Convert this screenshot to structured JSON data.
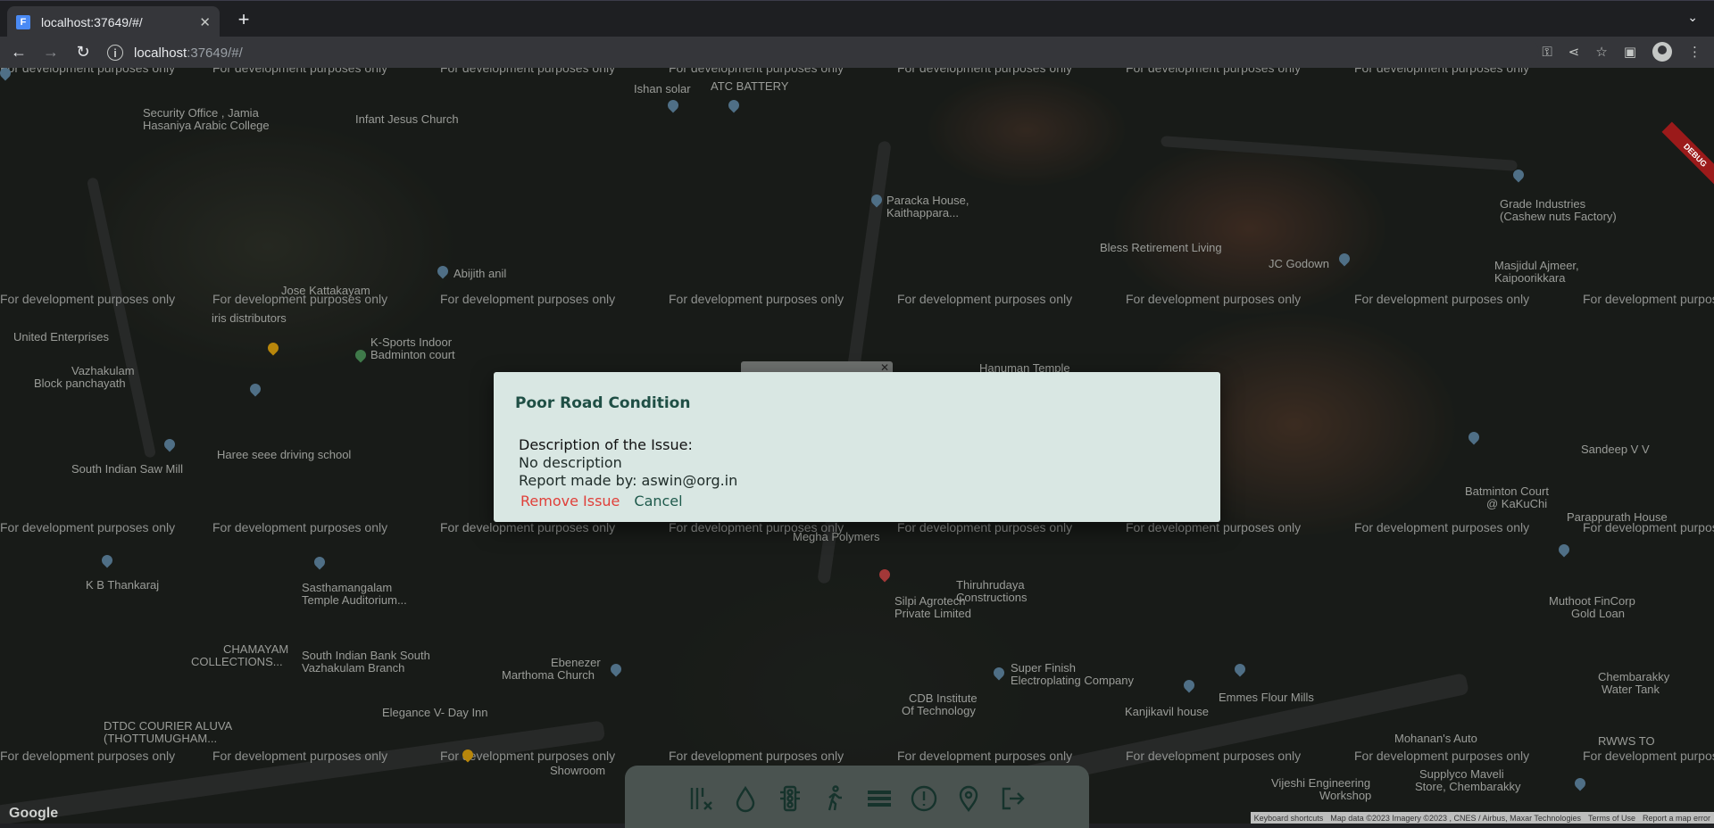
{
  "browser": {
    "tab_title": "localhost:37649/#/",
    "tab_close": "✕",
    "new_tab": "+",
    "url_host": "localhost",
    "url_path": ":37649/#/"
  },
  "map": {
    "watermark": "For development purposes only",
    "debug_label": "DEBUG",
    "google_logo": "Google",
    "attribution": [
      "Keyboard shortcuts",
      "Map data ©2023 Imagery ©2023 , CNES / Airbus, Maxar Technologies",
      "Terms of Use",
      "Report a map error"
    ],
    "places": [
      "Ishan solar",
      "ATC BATTERY",
      "Security Office , Jamia",
      "Hasaniya Arabic College",
      "Infant Jesus Church",
      "Paracka House,",
      "Kaithappara...",
      "Grade Industries",
      "(Cashew nuts Factory)",
      "Bless Retirement Living",
      "JC Godown",
      "Masjidul Ajmeer,",
      "Kaipoorikkara",
      "Abijith anil",
      "Jose Kattakayam",
      "iris distributors",
      "K-Sports Indoor",
      "Badminton court",
      "United Enterprises",
      "Vazhakulam",
      "Block panchayath",
      "Haree seee driving school",
      "South Indian Saw Mill",
      "Sandeep V V",
      "Batminton Court",
      "@ KaKuChi",
      "Parappurath House",
      "K B Thankaraj",
      "Sasthamangalam",
      "Temple Auditorium...",
      "Megha Polymers",
      "Thiruhrudaya",
      "Constructions",
      "Silpi Agrotech",
      "Private Limited",
      "Muthoot FinCorp",
      "Gold Loan",
      "CHAMAYAM",
      "COLLECTIONS...",
      "South Indian Bank South",
      "Vazhakulam Branch",
      "Ebenezer",
      "Marthoma Church",
      "Super Finish",
      "Electroplating Company",
      "CDB Institute",
      "Of Technology",
      "Emmes Flour Mills",
      "Kanjikavil house",
      "DTDC COURIER ALUVA",
      "(THOTTUMUGHAM...",
      "Elegance V- Day Inn",
      "Showroom",
      "Vijeshi Engineering",
      "Workshop",
      "Mohanan's Auto",
      "Supplyco Maveli",
      "Store, Chembarakky",
      "RWWS TO",
      "Chembarakky",
      "Water Tank",
      "Hanuman Temple"
    ]
  },
  "dialog": {
    "title": "Poor Road Condition",
    "description_heading": "Description of the Issue:",
    "description": "No description",
    "reporter": "Report made by: aswin@org.in",
    "remove_label": "Remove Issue",
    "cancel_label": "Cancel"
  },
  "bottom_nav": {
    "icons": [
      "traffic-signal-filter-icon",
      "water-drop-icon",
      "traffic-light-icon",
      "pedestrian-icon",
      "road-icon",
      "alert-icon",
      "location-pin-icon",
      "logout-icon"
    ]
  }
}
